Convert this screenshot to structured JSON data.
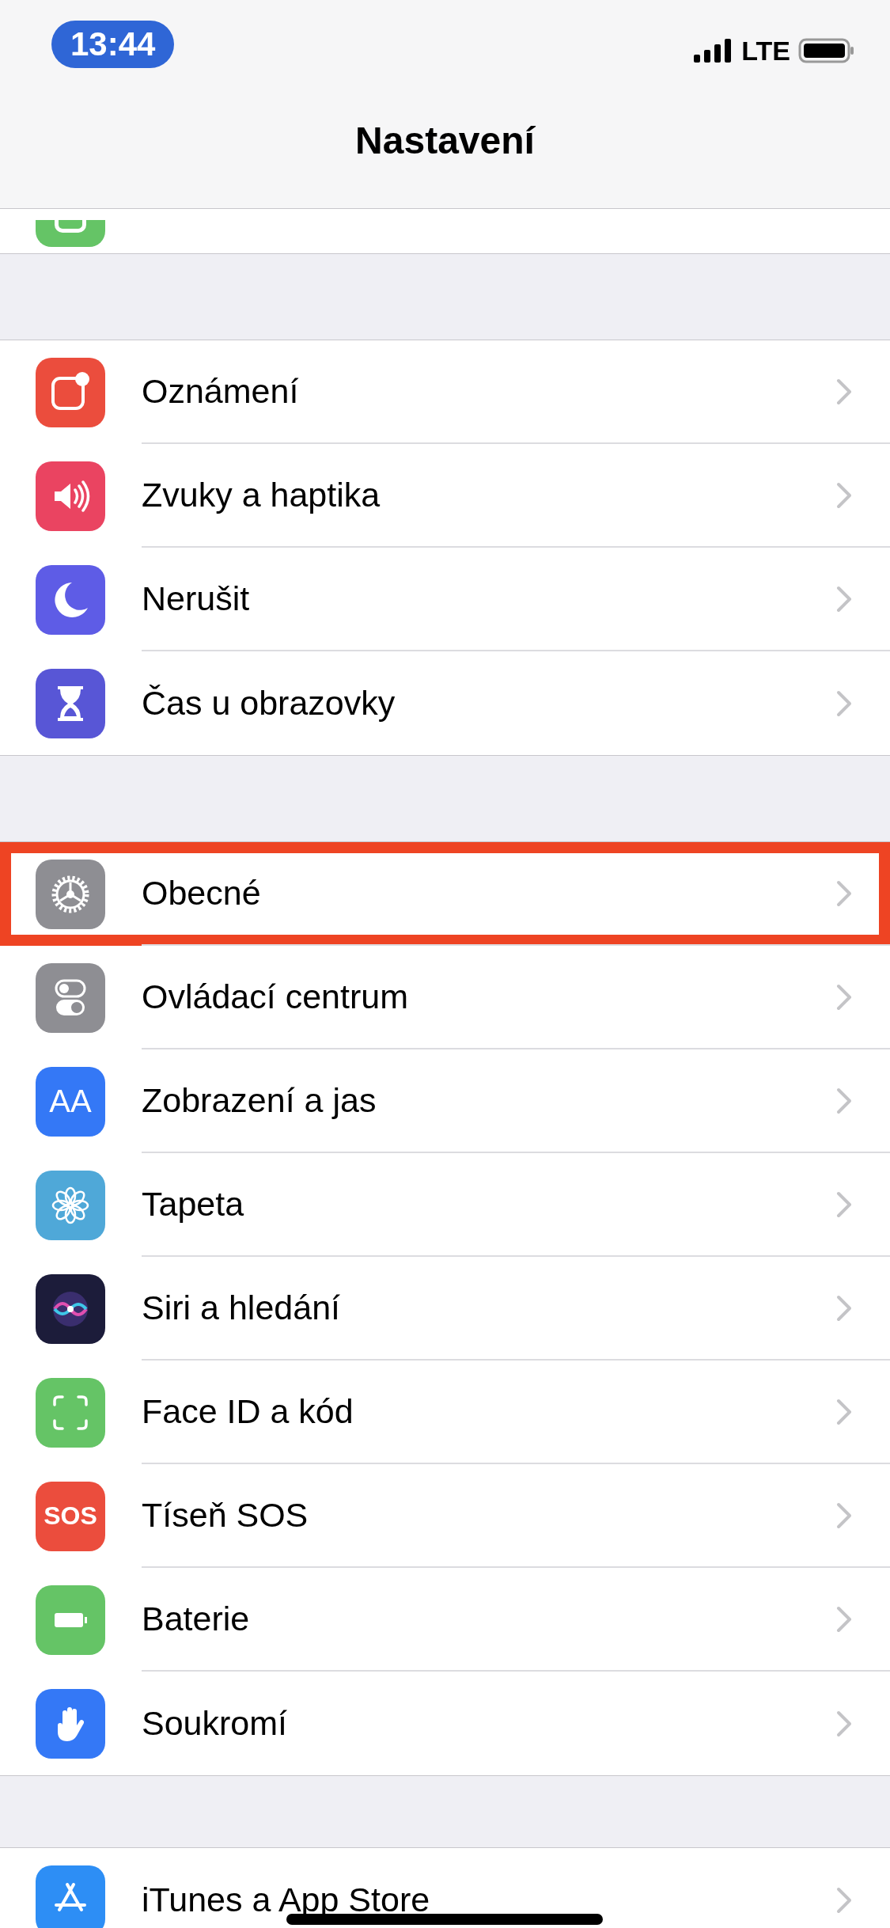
{
  "status_bar": {
    "time": "13:44",
    "network": "LTE"
  },
  "title": "Nastavení",
  "hidden_row": {
    "kind": "hotspot",
    "color": "#65c466"
  },
  "groups": [
    {
      "rows": [
        {
          "label": "Oznámení",
          "kind": "notifications",
          "color": "#eb4d3d",
          "highlighted": false
        },
        {
          "label": "Zvuky a haptika",
          "kind": "sounds",
          "color": "#ea4461",
          "highlighted": false
        },
        {
          "label": "Nerušit",
          "kind": "moon",
          "color": "#5e5ce6",
          "highlighted": false
        },
        {
          "label": "Čas u obrazovky",
          "kind": "hourglass",
          "color": "#5856d6",
          "highlighted": false
        }
      ]
    },
    {
      "rows": [
        {
          "label": "Obecné",
          "kind": "gear",
          "color": "#8e8e93",
          "highlighted": true
        },
        {
          "label": "Ovládací centrum",
          "kind": "toggles",
          "color": "#8e8e93",
          "highlighted": false
        },
        {
          "label": "Zobrazení a jas",
          "kind": "text",
          "icon_text": "AA",
          "color": "#3478f6",
          "highlighted": false
        },
        {
          "label": "Tapeta",
          "kind": "flower",
          "color": "#4fa8d8",
          "highlighted": false
        },
        {
          "label": "Siri a hledání",
          "kind": "siri",
          "color": "#1c1c3a",
          "highlighted": false
        },
        {
          "label": "Face ID a kód",
          "kind": "face",
          "color": "#65c466",
          "highlighted": false
        },
        {
          "label": "Tíseň SOS",
          "kind": "text",
          "icon_text": "SOS",
          "color": "#eb4d3d",
          "highlighted": false
        },
        {
          "label": "Baterie",
          "kind": "battery",
          "color": "#65c466",
          "highlighted": false
        },
        {
          "label": "Soukromí",
          "kind": "hand",
          "color": "#3478f6",
          "highlighted": false
        }
      ]
    },
    {
      "rows": [
        {
          "label": "iTunes a App Store",
          "kind": "appstore",
          "color": "#2d8ef5",
          "highlighted": false
        }
      ]
    }
  ]
}
